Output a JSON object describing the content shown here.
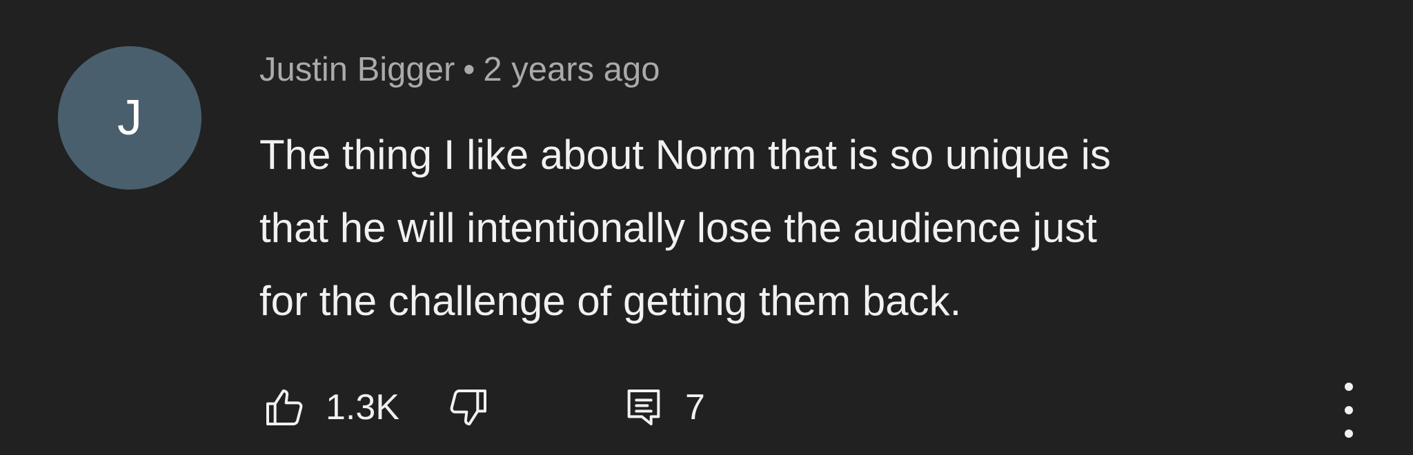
{
  "comment": {
    "avatar_letter": "J",
    "author": "Justin Bigger",
    "separator": "•",
    "timestamp": "2 years ago",
    "body_lines": [
      "The thing I like about Norm that is so unique is",
      "that he will intentionally lose the audience just",
      "for the challenge of getting them back."
    ]
  },
  "actions": {
    "like_count": "1.3K",
    "reply_count": "7"
  },
  "icons": {
    "like": "thumbs-up-icon",
    "dislike": "thumbs-down-icon",
    "reply": "comment-icon",
    "more": "more-vertical-icon"
  },
  "colors": {
    "background": "#212121",
    "avatar": "#4a5f6d",
    "meta_text": "#aaaaaa",
    "body_text": "#f1f1f1"
  }
}
